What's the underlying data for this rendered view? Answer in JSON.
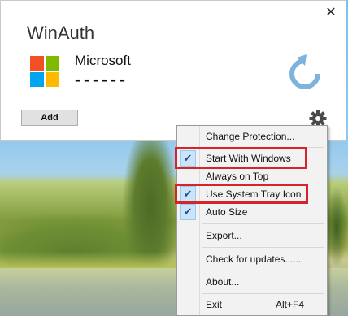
{
  "window": {
    "title": "WinAuth",
    "minimize_glyph": "_",
    "close_glyph": "✕"
  },
  "account": {
    "name": "Microsoft",
    "code": "------",
    "logo": "microsoft-logo",
    "refresh_icon": "refresh-icon"
  },
  "toolbar": {
    "add_label": "Add",
    "settings_icon": "gear-icon"
  },
  "menu": {
    "items": [
      {
        "label": "Change Protection...",
        "checked": false
      },
      {
        "label": "Start With Windows",
        "checked": true,
        "highlighted": true
      },
      {
        "label": "Always on Top",
        "checked": false
      },
      {
        "label": "Use System Tray Icon",
        "checked": true,
        "highlighted": true
      },
      {
        "label": "Auto Size",
        "checked": true
      },
      {
        "label": "Export...",
        "checked": false
      },
      {
        "label": "Check for updates......",
        "checked": false
      },
      {
        "label": "About...",
        "checked": false
      },
      {
        "label": "Exit",
        "shortcut": "Alt+F4",
        "checked": false
      }
    ],
    "check_glyph": "✔"
  },
  "colors": {
    "highlight_border": "#d6242d",
    "refresh_icon": "#7eb4dc",
    "check_bg": "#cce4f7"
  }
}
